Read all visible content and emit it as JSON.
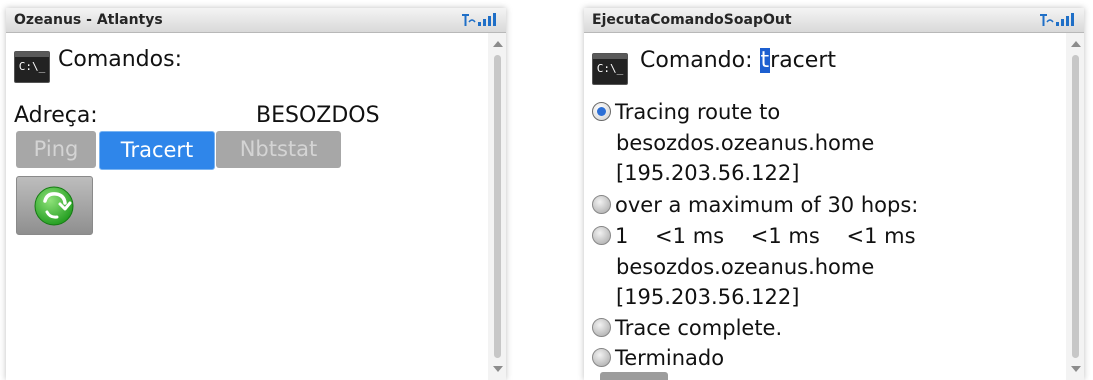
{
  "left_screen": {
    "title": "Ozeanus - Atlantys",
    "cmd_icon_text": "C:\\_",
    "heading": "Comandos:",
    "address_label": "Adreça:",
    "address_value": "BESOZDOS",
    "buttons": [
      {
        "label": "Ping",
        "selected": false
      },
      {
        "label": "Tracert",
        "selected": true
      },
      {
        "label": "Nbtstat",
        "selected": false
      }
    ],
    "go_icon": "green-arrow-refresh-icon"
  },
  "right_screen": {
    "title": "EjecutaComandoSoapOut",
    "cmd_icon_text": "C:\\_",
    "command_label": "Comando:",
    "command_value_first": "t",
    "command_value_rest": "racert",
    "lines": [
      {
        "radio": "selected",
        "text": "Tracing route to"
      },
      {
        "radio": "none",
        "text": "besozdos.ozeanus.home"
      },
      {
        "radio": "none",
        "text": "[195.203.56.122]"
      },
      {
        "radio": "unselected",
        "text": "over a maximum of 30 hops:"
      },
      {
        "radio": "unselected",
        "text": "1    <1 ms    <1 ms    <1 ms"
      },
      {
        "radio": "none",
        "text": "besozdos.ozeanus.home"
      },
      {
        "radio": "none",
        "text": "[195.203.56.122]"
      },
      {
        "radio": "unselected",
        "text": "Trace complete."
      },
      {
        "radio": "unselected",
        "text": "Terminado"
      }
    ]
  },
  "colors": {
    "accent_blue": "#2f86ea",
    "disabled_gray": "#a7a7a7",
    "go_green": "#2fb52a"
  }
}
